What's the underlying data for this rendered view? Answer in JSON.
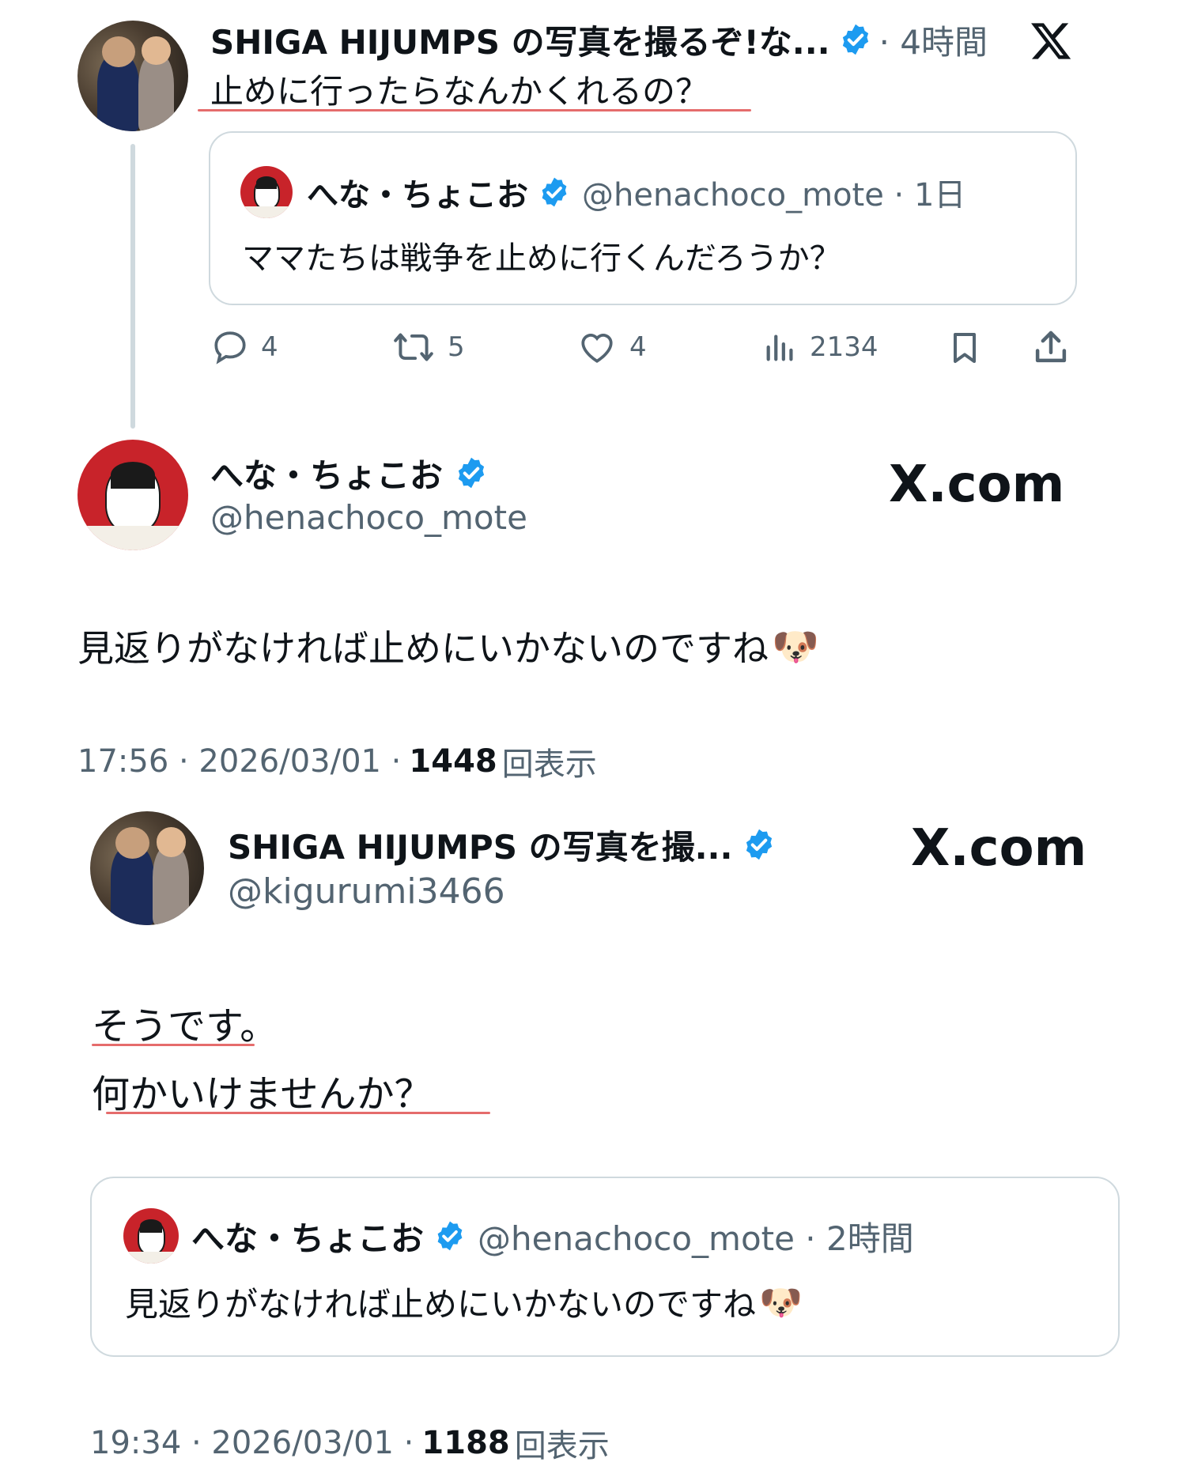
{
  "tweet1": {
    "author_name": "SHIGA HIJUMPS の写真を撮るぞ!な...",
    "time": "· 4時間",
    "text": "止めに行ったらなんかくれるの？",
    "quote": {
      "author_name": "へな・ちょこお",
      "handle_time": "@henachoco_mote · 1日",
      "text": "ママたちは戦争を止めに行くんだろうか？"
    },
    "actions": {
      "replies": "4",
      "retweets": "5",
      "likes": "4",
      "views": "2134"
    }
  },
  "post2": {
    "author_name": "へな・ちょこお",
    "handle": "@henachoco_mote",
    "site": "X.com",
    "text": "見返りがなければ止めにいかないのですね",
    "emoji": "🐶",
    "meta_time": "17:56 · 2026/03/01 · ",
    "meta_count": "1448",
    "meta_suffix": "回表示"
  },
  "post3": {
    "author_name": "SHIGA HIJUMPS の写真を撮...",
    "handle": "@kigurumi3466",
    "site": "X.com",
    "text_line1": "そうです。",
    "text_line2": "何かいけませんか？",
    "quote": {
      "author_name": "へな・ちょこお",
      "handle_time": "@henachoco_mote · 2時間",
      "text": "見返りがなければ止めにいかないのですね",
      "emoji": "🐶"
    },
    "meta_time": "19:34 · 2026/03/01 · ",
    "meta_count": "1188",
    "meta_suffix": "回表示"
  },
  "colors": {
    "verified": "#1d9bf0",
    "muted": "#536471",
    "underline": "#e05252",
    "thread_line": "#cfd9de"
  },
  "icons": [
    "verified-badge-icon",
    "x-logo-icon",
    "reply-icon",
    "retweet-icon",
    "like-icon",
    "views-icon",
    "bookmark-icon",
    "share-icon"
  ]
}
